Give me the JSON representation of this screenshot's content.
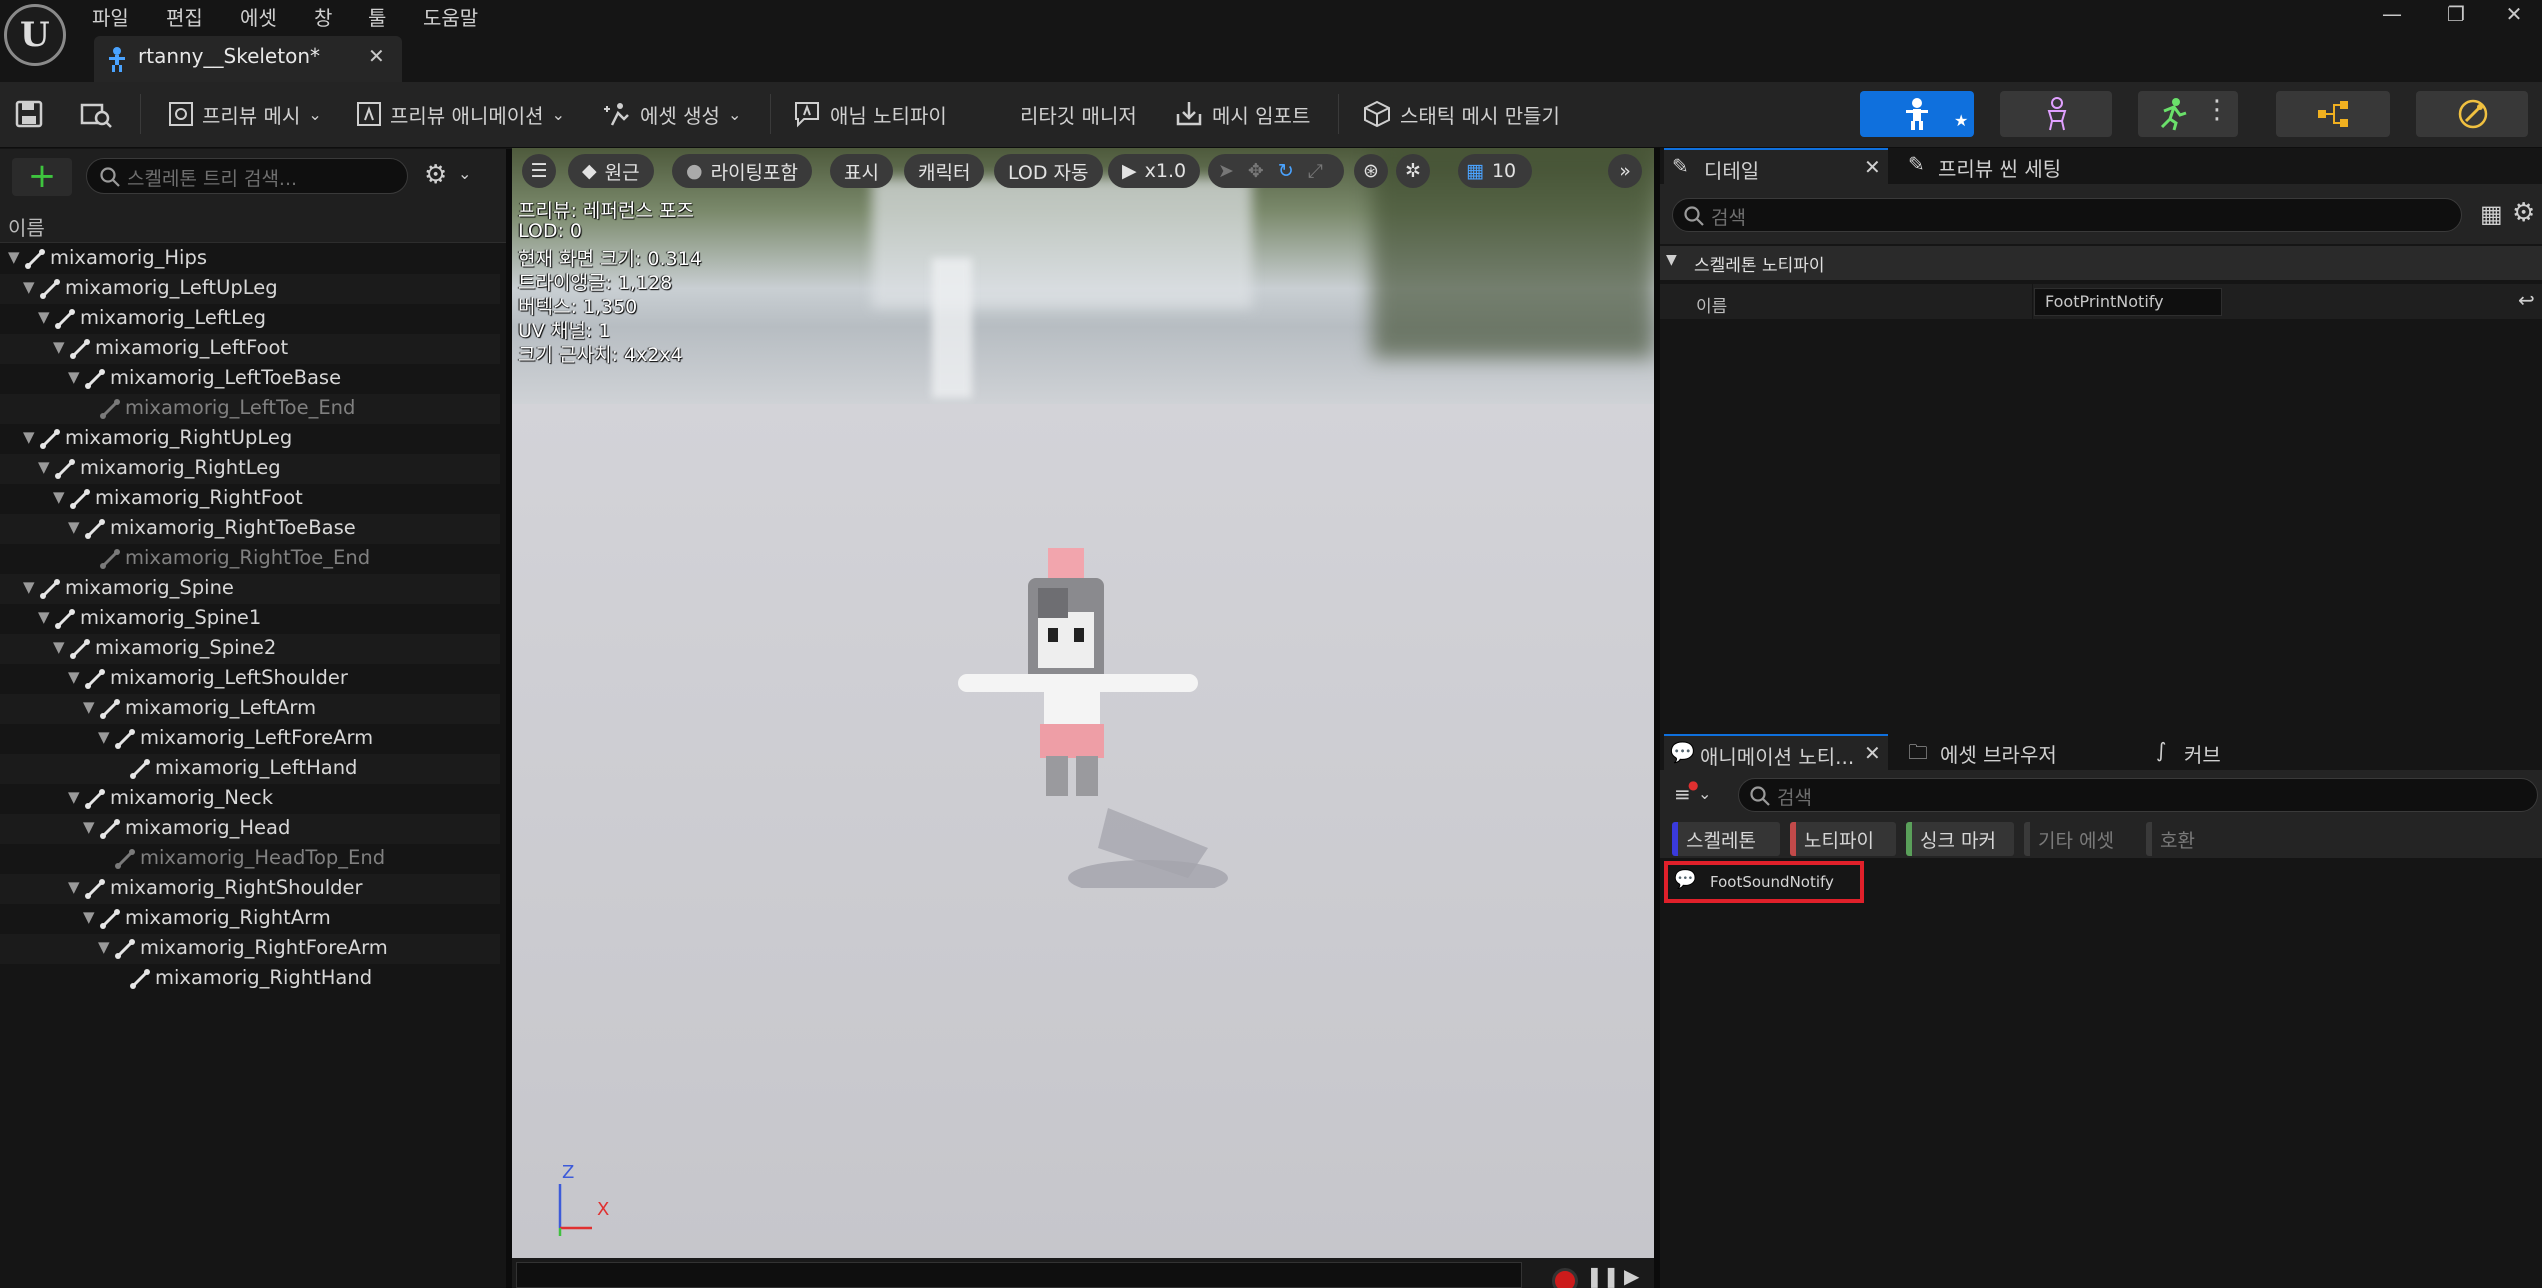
{
  "menu": [
    "파일",
    "편집",
    "에셋",
    "창",
    "툴",
    "도움말"
  ],
  "document_tab": {
    "title": "rtanny__Skeleton*"
  },
  "window_buttons": {
    "minimize": "—",
    "restore": "❐",
    "close": "✕"
  },
  "toolbar": {
    "preview_mesh": "프리뷰 메시",
    "preview_animation": "프리뷰 애니메이션",
    "create_asset": "에셋 생성",
    "anim_notify": "애님 노티파이",
    "retarget_manager": "리타깃 매니저",
    "mesh_import": "메시 임포트",
    "static_mesh": "스태틱 메시 만들기"
  },
  "skeleton_tree": {
    "search_placeholder": "스켈레톤 트리 검색...",
    "column_header": "이름",
    "bones": [
      {
        "name": "mixamorig_Hips",
        "depth": 0,
        "has_children": true,
        "dim": false
      },
      {
        "name": "mixamorig_LeftUpLeg",
        "depth": 1,
        "has_children": true,
        "dim": false
      },
      {
        "name": "mixamorig_LeftLeg",
        "depth": 2,
        "has_children": true,
        "dim": false
      },
      {
        "name": "mixamorig_LeftFoot",
        "depth": 3,
        "has_children": true,
        "dim": false
      },
      {
        "name": "mixamorig_LeftToeBase",
        "depth": 4,
        "has_children": true,
        "dim": false
      },
      {
        "name": "mixamorig_LeftToe_End",
        "depth": 5,
        "has_children": false,
        "dim": true
      },
      {
        "name": "mixamorig_RightUpLeg",
        "depth": 1,
        "has_children": true,
        "dim": false
      },
      {
        "name": "mixamorig_RightLeg",
        "depth": 2,
        "has_children": true,
        "dim": false
      },
      {
        "name": "mixamorig_RightFoot",
        "depth": 3,
        "has_children": true,
        "dim": false
      },
      {
        "name": "mixamorig_RightToeBase",
        "depth": 4,
        "has_children": true,
        "dim": false
      },
      {
        "name": "mixamorig_RightToe_End",
        "depth": 5,
        "has_children": false,
        "dim": true
      },
      {
        "name": "mixamorig_Spine",
        "depth": 1,
        "has_children": true,
        "dim": false
      },
      {
        "name": "mixamorig_Spine1",
        "depth": 2,
        "has_children": true,
        "dim": false
      },
      {
        "name": "mixamorig_Spine2",
        "depth": 3,
        "has_children": true,
        "dim": false
      },
      {
        "name": "mixamorig_LeftShoulder",
        "depth": 4,
        "has_children": true,
        "dim": false
      },
      {
        "name": "mixamorig_LeftArm",
        "depth": 5,
        "has_children": true,
        "dim": false
      },
      {
        "name": "mixamorig_LeftForeArm",
        "depth": 6,
        "has_children": true,
        "dim": false
      },
      {
        "name": "mixamorig_LeftHand",
        "depth": 7,
        "has_children": false,
        "dim": false
      },
      {
        "name": "mixamorig_Neck",
        "depth": 4,
        "has_children": true,
        "dim": false
      },
      {
        "name": "mixamorig_Head",
        "depth": 5,
        "has_children": true,
        "dim": false
      },
      {
        "name": "mixamorig_HeadTop_End",
        "depth": 6,
        "has_children": false,
        "dim": true
      },
      {
        "name": "mixamorig_RightShoulder",
        "depth": 4,
        "has_children": true,
        "dim": false
      },
      {
        "name": "mixamorig_RightArm",
        "depth": 5,
        "has_children": true,
        "dim": false
      },
      {
        "name": "mixamorig_RightForeArm",
        "depth": 6,
        "has_children": true,
        "dim": false
      },
      {
        "name": "mixamorig_RightHand",
        "depth": 7,
        "has_children": false,
        "dim": false
      }
    ]
  },
  "viewport": {
    "perspective": "원근",
    "lighting": "라이팅포함",
    "show": "표시",
    "character": "캐릭터",
    "lod": "LOD 자동",
    "speed": "x1.0",
    "grid_size": "10",
    "stats": [
      "프리뷰: 레퍼런스 포즈",
      "LOD: 0",
      "현재 화면 크기: 0.314",
      "트라이앵글: 1,128",
      "버텍스: 1,350",
      "UV 채널: 1",
      "크기 근사치: 4x2x4"
    ],
    "axis_z": "Z",
    "axis_x": "X"
  },
  "details": {
    "tab_details": "디테일",
    "tab_preview_scene": "프리뷰 씬 세팅",
    "search_placeholder": "검색",
    "section": "스켈레톤 노티파이",
    "name_label": "이름",
    "name_value": "FootPrintNotify"
  },
  "anim_notifies": {
    "tab_notifies": "애니메이션 노티...",
    "tab_asset_browser": "에셋 브라우저",
    "tab_curves": "커브",
    "search_placeholder": "검색",
    "filters": [
      {
        "label": "스켈레톤",
        "color": "#3a3adc",
        "on": true
      },
      {
        "label": "노티파이",
        "color": "#c24a4a",
        "on": true
      },
      {
        "label": "싱크 마커",
        "color": "#5aa05a",
        "on": true
      },
      {
        "label": "기타 에셋",
        "color": "#3a3a3a",
        "on": false
      },
      {
        "label": "호환",
        "color": "#3a3a3a",
        "on": false
      }
    ],
    "items": [
      "FootSoundNotify"
    ]
  },
  "colors": {
    "accent": "#0f70dd",
    "highlight": "#e0202a"
  }
}
